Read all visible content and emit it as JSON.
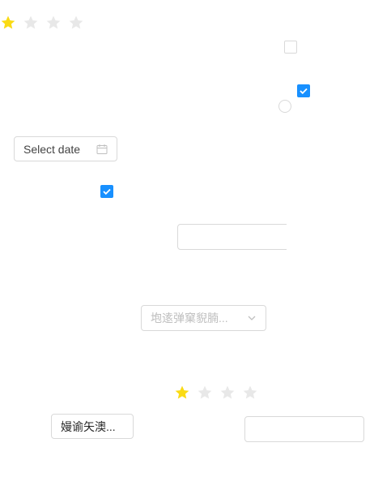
{
  "colors": {
    "star_active": "#fadb14",
    "star_inactive": "#e8e8e8",
    "primary": "#1890ff",
    "border": "#d9d9d9"
  },
  "rating_top": {
    "value": 1,
    "max": 4
  },
  "rating_mid": {
    "value": 1,
    "max": 4
  },
  "checkbox_top_right": {
    "checked": false
  },
  "checkbox_right": {
    "checked": true
  },
  "radio_right": {
    "checked": false
  },
  "checkbox_left": {
    "checked": true
  },
  "date_picker": {
    "placeholder": "Select date",
    "icon": "calendar-icon"
  },
  "text_input_partial": {
    "value": ""
  },
  "select_dropdown": {
    "placeholder": "垉逺弹窠貎腩...",
    "icon": "chevron-down-icon"
  },
  "small_button": {
    "label": "嫚谕矢澳..."
  },
  "text_input_bottom": {
    "value": ""
  }
}
